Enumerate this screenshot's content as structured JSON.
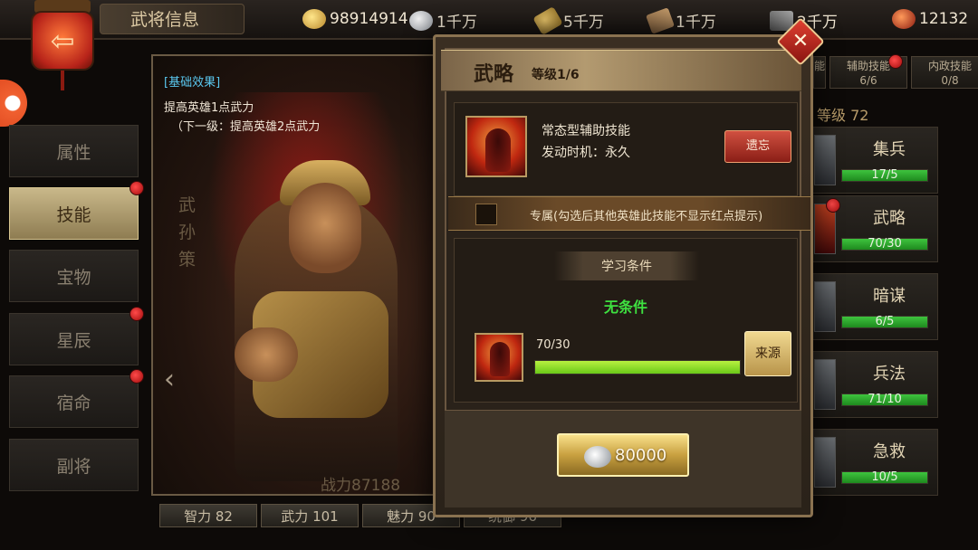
{
  "header": {
    "title": "武将信息",
    "resources": [
      {
        "icon": "gold-ingot-icon",
        "value": "98914914"
      },
      {
        "icon": "silver-coin-icon",
        "value": "1千万"
      },
      {
        "icon": "food-icon",
        "value": "5千万"
      },
      {
        "icon": "wood-icon",
        "value": "1千万"
      },
      {
        "icon": "iron-icon",
        "value": "2千万"
      },
      {
        "icon": "jade-icon",
        "value": "12132"
      }
    ]
  },
  "menu": {
    "items": [
      {
        "label": "属性",
        "active": false,
        "dot": false
      },
      {
        "label": "技能",
        "active": true,
        "dot": true
      },
      {
        "label": "宝物",
        "active": false,
        "dot": false
      },
      {
        "label": "星辰",
        "active": false,
        "dot": true
      },
      {
        "label": "宿命",
        "active": false,
        "dot": true
      },
      {
        "label": "副将",
        "active": false,
        "dot": false
      }
    ]
  },
  "hero": {
    "effect_title": "[基础效果]",
    "effect_line1": "提高英雄1点武力",
    "effect_line2": "（下一级：提高英雄2点武力",
    "name_vertical": "武孙策",
    "power": "战力87188"
  },
  "stats": [
    "智力 82",
    "武力 101",
    "魅力 90",
    "统御 96"
  ],
  "right_panel": {
    "tabs": [
      {
        "label": "能",
        "count": ""
      },
      {
        "label": "辅助技能",
        "count": "6/6"
      },
      {
        "label": "内政技能",
        "count": "0/8"
      }
    ],
    "level": "等级 72",
    "skills": [
      {
        "name": "集兵",
        "value": "17/5",
        "fill": 1.0,
        "dot": false
      },
      {
        "name": "武略",
        "value": "70/30",
        "fill": 1.0,
        "dot": true
      },
      {
        "name": "暗谋",
        "value": "6/5",
        "fill": 1.0,
        "dot": false
      },
      {
        "name": "兵法",
        "value": "71/10",
        "fill": 1.0,
        "dot": false
      },
      {
        "name": "急救",
        "value": "10/5",
        "fill": 1.0,
        "dot": false
      }
    ]
  },
  "modal": {
    "title": "武略",
    "level": "等级1/6",
    "close_label": "✕",
    "skill_type": "常态型辅助技能",
    "trigger": "发动时机：永久",
    "forget_label": "遗忘",
    "exclusive_text": "专属(勾选后其他英雄此技能不显示红点提示)",
    "exclusive_checked": false,
    "condition_title": "学习条件",
    "condition_value": "无条件",
    "progress_text": "70/30",
    "progress_fill": 1.0,
    "source_label": "来源",
    "cost_value": "80000"
  },
  "colors": {
    "accent_green": "#3ee040",
    "progress_green": "#b8f040",
    "red_dot": "#e02020",
    "gold_button": "#c8a040"
  }
}
